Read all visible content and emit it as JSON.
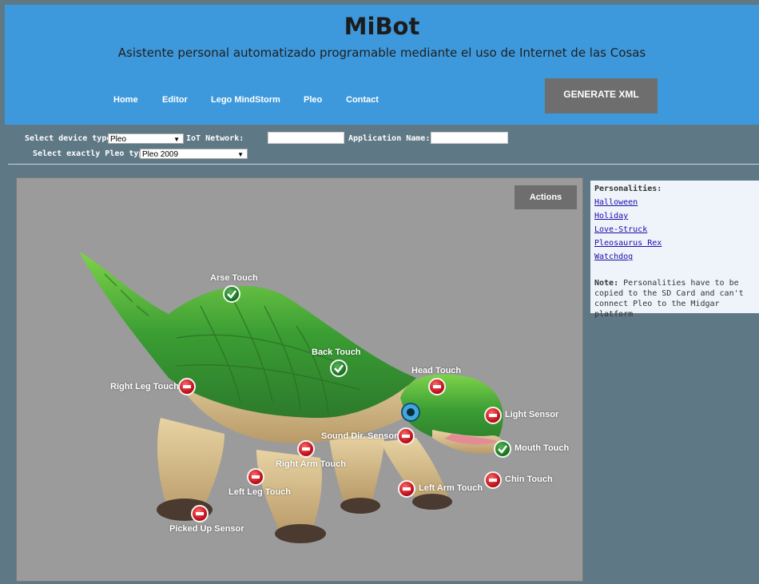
{
  "header": {
    "title": "MiBot",
    "subtitle": "Asistente personal automatizado programable mediante el uso de Internet de las Cosas",
    "nav": [
      "Home",
      "Editor",
      "Lego MindStorm",
      "Pleo",
      "Contact"
    ],
    "generate_label": "GENERATE XML"
  },
  "form": {
    "device_type_label": "Select device type:",
    "device_type_value": "Pleo",
    "iot_network_label": "IoT Network:",
    "iot_network_value": "",
    "app_name_label": "Application Name:",
    "app_name_value": "",
    "pleo_type_label": "Select exactly Pleo type:",
    "pleo_type_value": "Pleo 2009"
  },
  "canvas": {
    "actions_label": "Actions",
    "sensors": [
      {
        "label": "Arse Touch",
        "state": "on"
      },
      {
        "label": "Back Touch",
        "state": "on"
      },
      {
        "label": "Right Leg Touch",
        "state": "off"
      },
      {
        "label": "Head Touch",
        "state": "off"
      },
      {
        "label": "Light Sensor",
        "state": "off"
      },
      {
        "label": "Sound Dir. Sensor",
        "state": "off"
      },
      {
        "label": "Mouth Touch",
        "state": "on"
      },
      {
        "label": "Right Arm Touch",
        "state": "off"
      },
      {
        "label": "Chin Touch",
        "state": "off"
      },
      {
        "label": "Left Leg Touch",
        "state": "off"
      },
      {
        "label": "Left Arm Touch",
        "state": "off"
      },
      {
        "label": "Picked Up Sensor",
        "state": "off"
      }
    ]
  },
  "personalities": {
    "title": "Personalities:",
    "items": [
      "Halloween",
      "Holiday",
      "Love-Struck",
      "Pleosaurus Rex",
      "Watchdog"
    ],
    "note_label": "Note:",
    "note_text": "Personalities have to be copied to the SD Card and can't connect Pleo to the Midgar platform"
  },
  "colors": {
    "header_bg": "#3d99dc",
    "page_bg": "#5f7885",
    "button_bg": "#6e6e6e",
    "canvas_bg": "#9b9b9b",
    "sensor_on": "#1b7a1f",
    "sensor_off": "#c3121b"
  }
}
